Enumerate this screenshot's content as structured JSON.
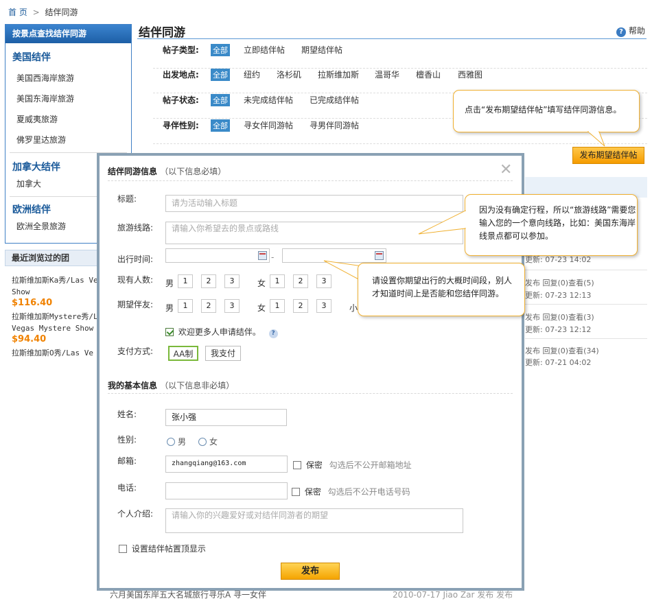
{
  "breadcrumb": {
    "home": "首 页",
    "sep": ">",
    "current": "结伴同游"
  },
  "sidebar": {
    "header": "按景点查找结伴同游",
    "groups": [
      {
        "title": "美国结伴",
        "items": [
          "美国西海岸旅游",
          "美国东海岸旅游",
          "夏威夷旅游",
          "佛罗里达旅游"
        ]
      },
      {
        "title": "加拿大结伴",
        "items": [
          "加拿大"
        ]
      },
      {
        "title": "欧洲结伴",
        "items": [
          "欧洲全景旅游"
        ]
      }
    ]
  },
  "recent": {
    "header": "最近浏览过的团",
    "items": [
      {
        "title1": "拉斯维加斯Ka秀/Las Ve",
        "title2": "Show",
        "price": "$116.40"
      },
      {
        "title1": "拉斯维加斯Mystere秀/L",
        "title2": "Vegas Mystere Show",
        "price": "$94.40"
      },
      {
        "title1": "拉斯维加斯O秀/Las Ve",
        "title2": "",
        "price": ""
      }
    ]
  },
  "main": {
    "title": "结伴同游",
    "help": "帮助",
    "filters": [
      {
        "label": "帖子类型:",
        "options": [
          "全部",
          "立即结伴帖",
          "期望结伴帖"
        ]
      },
      {
        "label": "出发地点:",
        "options": [
          "全部",
          "纽约",
          "洛杉矶",
          "拉斯维加斯",
          "温哥华",
          "檀香山",
          "西雅图"
        ]
      },
      {
        "label": "帖子状态:",
        "options": [
          "全部",
          "未完成结伴帖",
          "已完成结伴帖"
        ]
      },
      {
        "label": "寻伴性别:",
        "options": [
          "全部",
          "寻女伴同游帖",
          "寻男伴同游帖"
        ]
      }
    ],
    "callout_publish": "点击“发布期望结伴帖”填写结伴同游信息。",
    "publish_button": "发布期望结伴帖"
  },
  "bg_list": [
    {
      "l1": "",
      "l2": "更新: 07-23 14:02"
    },
    {
      "l1": "发布  回复(0)查看(5)",
      "l2": "更新: 07-23 12:13"
    },
    {
      "l1": "发布  回复(0)查看(3)",
      "l2": "更新: 07-23 12:12"
    },
    {
      "l1": "发布  回复(0)查看(34)",
      "l2": "更新: 07-21 04:02"
    }
  ],
  "bg_bottom": "六月美国东岸五大名城旅行寻乐A 寻一女伴",
  "bg_bottom_right": "2010-07-17 Jiao Zar 发布  发布",
  "modal": {
    "section1": {
      "title": "结伴同游信息",
      "note": "（以下信息必填）"
    },
    "title_label": "标题:",
    "title_placeholder": "请为活动输入标题",
    "route_label": "旅游线路:",
    "route_placeholder": "请输入你希望去的景点或路线",
    "date_label": "出行时间:",
    "date_sep": "-",
    "current_label": "现有人数:",
    "expect_label": "期望伴友:",
    "male": "男",
    "female": "女",
    "child": "小孩",
    "nums": [
      "1",
      "2",
      "3"
    ],
    "welcome": "欢迎更多人申请结伴。",
    "welcome_help": "?",
    "pay_label": "支付方式:",
    "pay_options": [
      "AA制",
      "我支付"
    ],
    "section2": {
      "title": "我的基本信息",
      "note": "（以下信息非必填）"
    },
    "name_label": "姓名:",
    "name_value": "张小强",
    "gender_label": "性别:",
    "gender_options": [
      "男",
      "女"
    ],
    "email_label": "邮箱:",
    "email_value": "zhangqiang@163.com",
    "email_private": "保密",
    "email_hint": "勾选后不公开邮箱地址",
    "phone_label": "电话:",
    "phone_private": "保密",
    "phone_hint": "勾选后不公开电话号码",
    "intro_label": "个人介绍:",
    "intro_placeholder": "请输入你的兴趣爱好或对结伴同游者的期望",
    "pin": "设置结伴帖置顶显示",
    "submit": "发布",
    "close": "✕"
  },
  "callout_route": "因为没有确定行程，所以“旅游线路”需要您输入您的一个意向线路，比如：美国东海岸线景点都可以参加。",
  "callout_date": "请设置你期望出行的大概时间段，别人才知道时间上是否能和您结伴同游。"
}
